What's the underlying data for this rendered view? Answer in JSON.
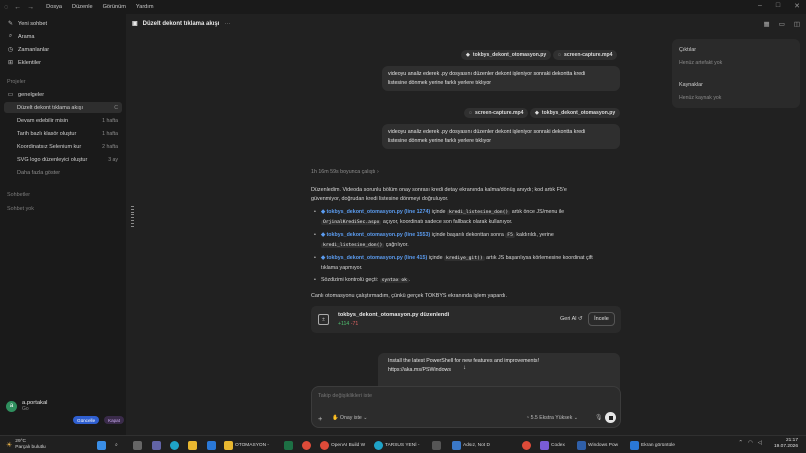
{
  "menu": {
    "items": [
      "Dosya",
      "Düzenle",
      "Görünüm",
      "Yardım"
    ]
  },
  "sidebar": {
    "top": [
      {
        "icon": "new-chat-icon",
        "label": "Yeni sohbet"
      },
      {
        "icon": "search-icon",
        "label": "Arama"
      },
      {
        "icon": "clock-icon",
        "label": "Zamanlanlar"
      },
      {
        "icon": "plugin-icon",
        "label": "Eklentiler"
      }
    ],
    "projects_header": "Projeler",
    "project": "genelgeler",
    "threads": [
      {
        "title": "Düzelt dekont tıklama akışı",
        "ago": "C"
      },
      {
        "title": "Devam edebilir misin",
        "ago": "1 hafta"
      },
      {
        "title": "Tarih bazlı klasör oluştur",
        "ago": "1 hafta"
      },
      {
        "title": "Koordinatsız Selenium kur",
        "ago": "2 hafta"
      },
      {
        "title": "SVG logo düzenleyici oluştur",
        "ago": "3 ay"
      }
    ],
    "more": "Daha fazla göster",
    "chats_header": "Sohbetler",
    "no_chats": "Sohbet yok",
    "user": {
      "initial": "a",
      "name": "a.portakal",
      "plan": "Go",
      "update_label": "Güncelle",
      "close_label": "Kapat"
    }
  },
  "thread": {
    "title": "Düzelt dekont tıklama akışı",
    "chips1": [
      "tokbys_dekont_otomasyon.py",
      "screen-capture.mp4"
    ],
    "msg1": [
      "videoyu analiz ederek .py dosyasını düzenler dekont işleniyor sonraki dekontta kredi",
      "listesine dönmek yerine farklı yerlere tıklıyor"
    ],
    "chips2": [
      "screen-capture.mp4",
      "tokbys_dekont_otomasyon.py"
    ],
    "msg2": [
      "videoyu analiz ederek .py dosyasını düzenler dekont işleniyor sonraki dekontta kredi",
      "listesine dönmek yerine farklı yerlere tıklıyor"
    ],
    "worked": "1h 16m 59s boyunca çalıştı",
    "intro": [
      "Düzenledim. Videoda sorunlu bölüm onay sonrası kredi detay ekranında kalma/dönüş anıydı; kod artık F5'e",
      "güvenmiyor, doğrudan kredi listesine dönmeyi doğruluyor."
    ],
    "b1": {
      "link": "tokbys_dekont_otomasyon.py (line 1274)",
      "t1": " içinde ",
      "code1": "kredi_listesine_don()",
      "t2": " artık önce JS/menu ile",
      "code2": "OrjinalKrediSec.aspx",
      "t3": " açıyor, koordinatı sadece son fallback olarak kullanıyor."
    },
    "b2": {
      "link": "tokbys_dekont_otomasyon.py (line 1553)",
      "t1": " içinde başarılı dekonttan sonra ",
      "code1": "F5",
      "t2": " kaldırıldı, yerine",
      "code2": "kredi_listesine_don()",
      "t3": " çağrılıyor."
    },
    "b3": {
      "link": "tokbys_dekont_otomasyon.py (line 415)",
      "t1": " içinde ",
      "code1": "krediye_git()",
      "t2": " artık JS başarılıysa körlemesine koordinat çift",
      "t3": "tıklama yapmıyor."
    },
    "b4": {
      "t1": "Sözdizimi kontrolü geçti: ",
      "code1": "syntax ok",
      "t2": "."
    },
    "outro": "Canlı otomasyonu çalıştırmadım, çünkü gerçek TOKBYS ekranında işlem yapardı.",
    "edit": {
      "file": "tokbys_dekont_otomasyon.py düzenlendi",
      "added": "+114",
      "removed": "-71",
      "undo": "Geri Al ↺",
      "review": "İncele"
    },
    "ps": [
      "Install the latest PowerShell for new features and improvements!",
      "https://aka.ms/PSWindows"
    ]
  },
  "composer": {
    "placeholder": "Takip değişiklikleri iste",
    "approval": "Onay iste",
    "model": "5.5  Ekstra Yüksek"
  },
  "panel": {
    "artifacts": "Çıktılar",
    "no_artifacts": "Henüz artefakt yok",
    "sources": "Kaynaklar",
    "no_sources": "Henüz kaynak yok"
  },
  "taskbar": {
    "weather_temp": "29°C",
    "weather_desc": "Parçalı bulutlu",
    "apps": [
      "OTOMASYON -",
      "OpenAI Build W",
      "TARSUS YENİ -",
      "Adsız, Not D",
      "Codex",
      "Windows Pow",
      "Ekran görüntüle"
    ],
    "time": "21:17",
    "date": "19.07.2026"
  }
}
